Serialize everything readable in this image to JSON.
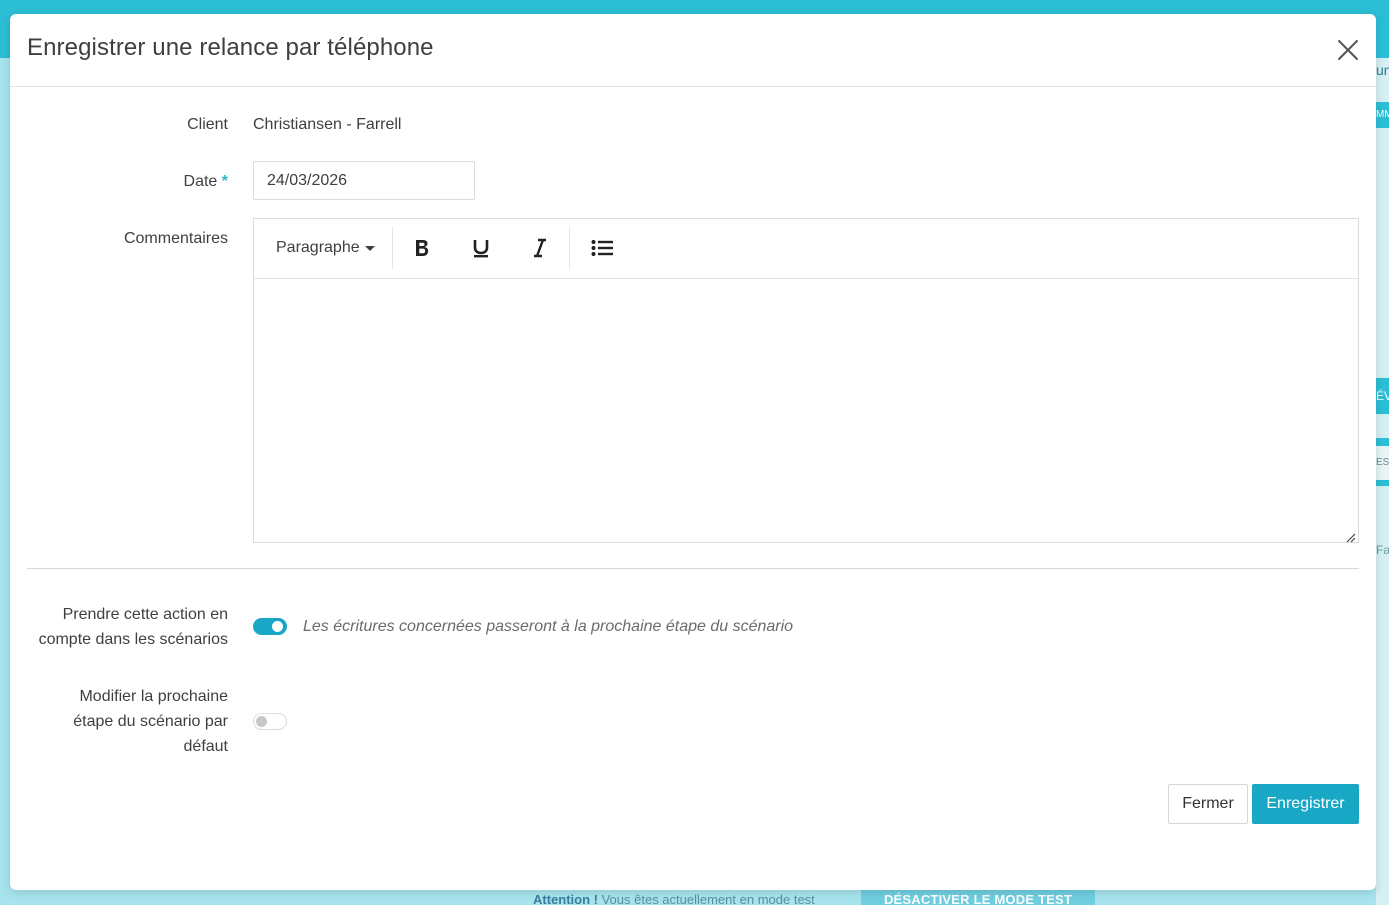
{
  "background": {
    "right_edge_texts": [
      "un",
      "MM",
      "ÉV",
      "ES",
      "Fa"
    ],
    "warning_bold": "Attention !",
    "warning_text": " Vous êtes actuellement en mode test",
    "deactivate_button": "DÉSACTIVER LE MODE TEST"
  },
  "modal": {
    "title": "Enregistrer une relance par téléphone",
    "close_icon": "close-icon",
    "client": {
      "label": "Client",
      "value": "Christiansen - Farrell"
    },
    "date": {
      "label": "Date",
      "required_marker": "*",
      "value": "24/03/2026"
    },
    "comments": {
      "label": "Commentaires",
      "toolbar": {
        "paragraph_label": "Paragraphe",
        "bold_icon": "bold-icon",
        "underline_icon": "underline-icon",
        "italic_icon": "italic-icon",
        "list_icon": "bullet-list-icon"
      },
      "content": ""
    },
    "scenario_action": {
      "label_line1": "Prendre cette action en",
      "label_line2": "compte dans les scénarios",
      "enabled": true,
      "hint": "Les écritures concernées passeront à la prochaine étape du scénario"
    },
    "modify_next_step": {
      "label_line1": "Modifier la prochaine",
      "label_line2": "étape du scénario par",
      "label_line3": "défaut",
      "enabled": false
    },
    "buttons": {
      "close": "Fermer",
      "save": "Enregistrer"
    }
  },
  "colors": {
    "accent": "#18a8c5",
    "topbar": "#2bbfd6",
    "overlay_bg": "#a8e4ee"
  }
}
